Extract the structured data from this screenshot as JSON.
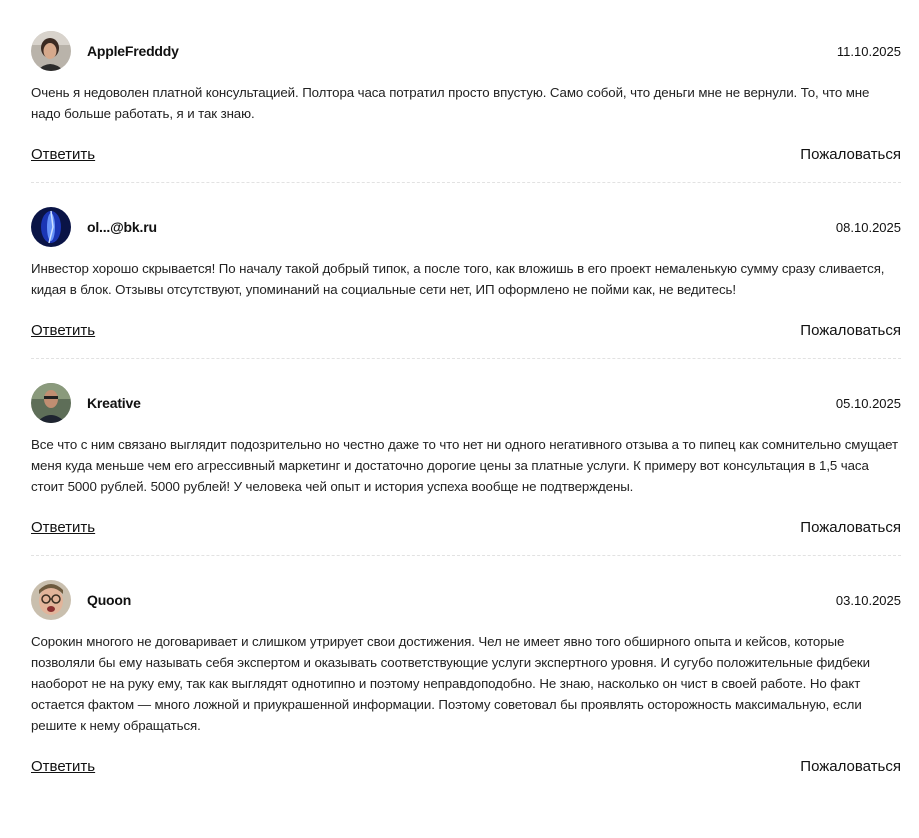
{
  "reviews": [
    {
      "author": "AppleFredddy",
      "date": "11.10.2025",
      "avatar": "avatar-photo-dark-hair",
      "text": "Очень я недоволен платной консультацией. Полтора часа потратил просто впустую. Само собой, что деньги мне не вернули. То, что мне надо больше работать, я и так знаю.",
      "reply_label": "Ответить",
      "report_label": "Пожаловаться"
    },
    {
      "author": "ol...@bk.ru",
      "date": "08.10.2025",
      "avatar": "avatar-blue-light",
      "text": "Инвестор хорошо скрывается! По началу такой добрый типок, а после того, как вложишь в его проект немаленькую сумму сразу сливается, кидая в блок. Отзывы отсутствуют, упоминаний на социальные сети нет, ИП оформлено не пойми как, не ведитесь!",
      "reply_label": "Ответить",
      "report_label": "Пожаловаться"
    },
    {
      "author": "Kreative",
      "date": "05.10.2025",
      "avatar": "avatar-photo-man-outdoor",
      "text": "Все что с ним связано выглядит подозрительно но честно даже то что нет ни одного негативного отзыва а то пипец как сомнительно смущает меня куда меньше чем его агрессивный маркетинг и достаточно дорогие цены за платные услуги. К примеру вот консультация в 1,5 часа стоит 5000 рублей. 5000 рублей! У человека чей опыт и история успеха вообще не подтверждены.",
      "reply_label": "Ответить",
      "report_label": "Пожаловаться"
    },
    {
      "author": "Quoon",
      "date": "03.10.2025",
      "avatar": "avatar-photo-glasses",
      "text": "Сорокин многого не договаривает и слишком утрирует свои достижения. Чел не имеет явно того обширного опыта и кейсов, которые позволяли бы ему называть себя экспертом и оказывать соответствующие услуги экспертного уровня. И сугубо положительные фидбеки наоборот не на руку ему, так как выглядят однотипно и поэтому неправдоподобно. Не знаю, насколько он чист в своей работе. Но факт остается фактом — много ложной и приукрашенной информации. Поэтому советовал бы проявлять осторожность максимальную, если решите к нему обращаться.",
      "reply_label": "Ответить",
      "report_label": "Пожаловаться"
    }
  ]
}
